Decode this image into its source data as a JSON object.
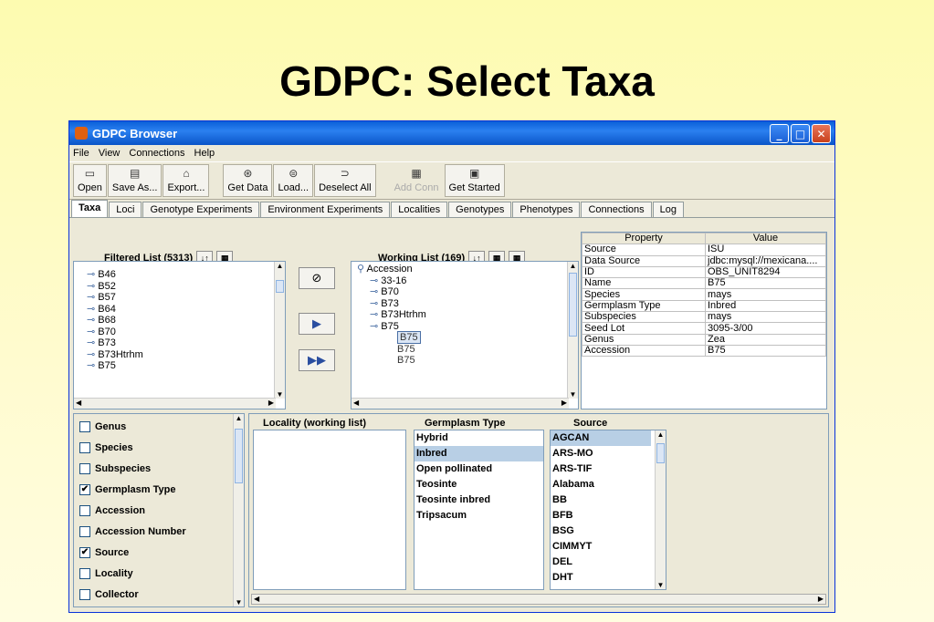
{
  "slide_title": "GDPC: Select Taxa",
  "window": {
    "title": "GDPC Browser"
  },
  "menu": [
    "File",
    "View",
    "Connections",
    "Help"
  ],
  "toolbar": [
    {
      "label": "Open",
      "icon": "folder-icon"
    },
    {
      "label": "Save As...",
      "icon": "save-icon"
    },
    {
      "label": "Export...",
      "icon": "export-icon"
    },
    {
      "label": "Get Data",
      "icon": "get-data-icon"
    },
    {
      "label": "Load...",
      "icon": "load-icon"
    },
    {
      "label": "Deselect All",
      "icon": "deselect-icon"
    },
    {
      "label": "Add Conn",
      "icon": "add-conn-icon",
      "disabled": true
    },
    {
      "label": "Get Started",
      "icon": "get-started-icon"
    }
  ],
  "tabs": [
    "Taxa",
    "Loci",
    "Genotype Experiments",
    "Environment Experiments",
    "Localities",
    "Genotypes",
    "Phenotypes",
    "Connections",
    "Log"
  ],
  "filtered_list": {
    "label": "Filtered List (5313)",
    "items": [
      "B46",
      "B52",
      "B57",
      "B64",
      "B68",
      "B70",
      "B73",
      "B73Htrhm",
      "B75"
    ]
  },
  "working_list": {
    "label": "Working List (169)",
    "root": "Accession",
    "items": [
      "33-16",
      "B70",
      "B73",
      "B73Htrhm",
      "B75"
    ],
    "children": [
      "B75",
      "B75",
      "B75"
    ]
  },
  "properties": {
    "headers": [
      "Property",
      "Value"
    ],
    "rows": [
      [
        "Source",
        "ISU"
      ],
      [
        "Data Source",
        "jdbc:mysql://mexicana...."
      ],
      [
        "ID",
        "OBS_UNIT8294"
      ],
      [
        "Name",
        "B75"
      ],
      [
        "Species",
        "mays"
      ],
      [
        "Germplasm Type",
        "Inbred"
      ],
      [
        "Subspecies",
        "mays"
      ],
      [
        "Seed Lot",
        "3095-3/00"
      ],
      [
        "Genus",
        "Zea"
      ],
      [
        "Accession",
        "B75"
      ]
    ]
  },
  "filters": [
    {
      "label": "Genus",
      "checked": false
    },
    {
      "label": "Species",
      "checked": false
    },
    {
      "label": "Subspecies",
      "checked": false
    },
    {
      "label": "Germplasm Type",
      "checked": true
    },
    {
      "label": "Accession",
      "checked": false
    },
    {
      "label": "Accession Number",
      "checked": false
    },
    {
      "label": "Source",
      "checked": true
    },
    {
      "label": "Locality",
      "checked": false
    },
    {
      "label": "Collector",
      "checked": false
    }
  ],
  "locality_label": "Locality (working list)",
  "germplasm": {
    "label": "Germplasm Type",
    "items": [
      "Hybrid",
      "Inbred",
      "Open pollinated",
      "Teosinte",
      "Teosinte inbred",
      "Tripsacum"
    ],
    "selected": "Inbred"
  },
  "source": {
    "label": "Source",
    "items": [
      "AGCAN",
      "ARS-MO",
      "ARS-TIF",
      "Alabama",
      "BB",
      "BFB",
      "BSG",
      "CIMMYT",
      "DEL",
      "DHT"
    ],
    "selected": "AGCAN"
  }
}
